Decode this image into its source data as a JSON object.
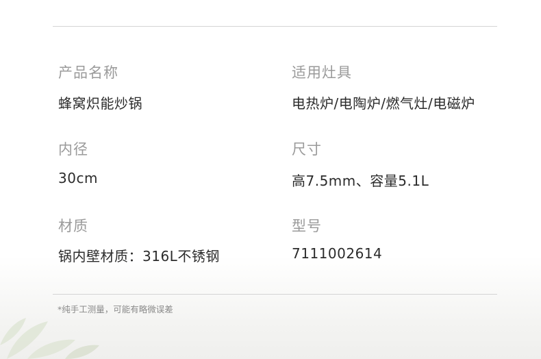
{
  "specs": [
    {
      "label": "产品名称",
      "value": "蜂窝炽能炒锅"
    },
    {
      "label": "适用灶具",
      "value": "电热炉/电陶炉/燃气灶/电磁炉"
    },
    {
      "label": "内径",
      "value": "30cm"
    },
    {
      "label": "尺寸",
      "value": "高7.5mm、容量5.1L"
    },
    {
      "label": "材质",
      "value": "锅内壁材质：316L不锈钢"
    },
    {
      "label": "型号",
      "value": "7111002614"
    }
  ],
  "footnote": "*纯手工测量，可能有略微误差"
}
